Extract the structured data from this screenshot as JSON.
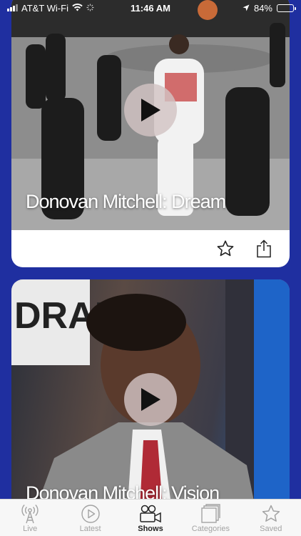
{
  "status_bar": {
    "carrier": "AT&T Wi-Fi",
    "time": "11:46 AM",
    "battery_text": "84%",
    "battery_level": 0.84
  },
  "cards": [
    {
      "title": "Donovan Mitchell: Dream"
    },
    {
      "title": "Donovan Mitchell: Vision"
    }
  ],
  "tabs": [
    {
      "label": "Live",
      "icon": "antenna-icon"
    },
    {
      "label": "Latest",
      "icon": "play-circle-icon"
    },
    {
      "label": "Shows",
      "icon": "video-camera-icon",
      "active": true
    },
    {
      "label": "Categories",
      "icon": "stacked-squares-icon"
    },
    {
      "label": "Saved",
      "icon": "star-icon"
    }
  ],
  "colors": {
    "background": "#1f2fa0",
    "tab_active": "#222222",
    "tab_inactive": "#a3a3a3"
  }
}
